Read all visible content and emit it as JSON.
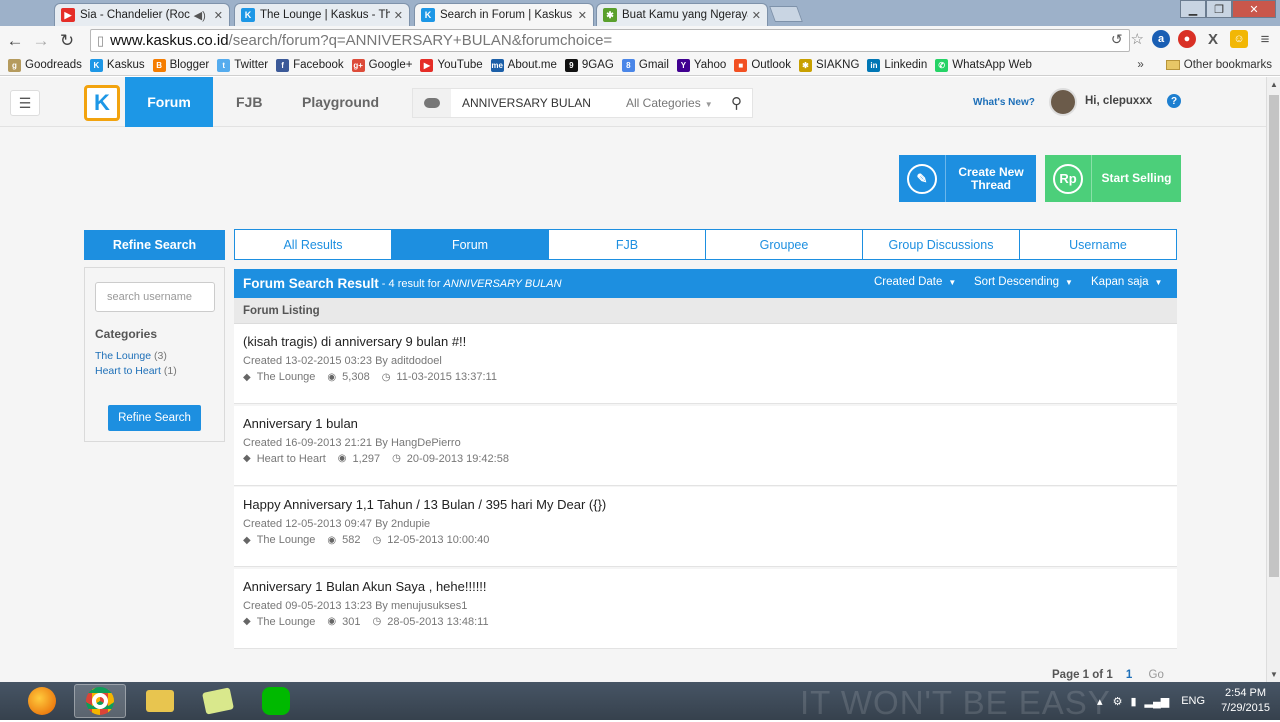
{
  "browser": {
    "tabs": [
      {
        "title": "Sia - Chandelier (Rock",
        "icon": "youtube-icon",
        "color": "#e52d27",
        "glyph": "▶"
      },
      {
        "title": "The Lounge | Kaskus - The",
        "icon": "kaskus-icon",
        "color": "#1d97e6",
        "glyph": "K"
      },
      {
        "title": "Search in Forum | Kaskus",
        "icon": "kaskus-icon",
        "color": "#1d97e6",
        "glyph": "K"
      },
      {
        "title": "Buat Kamu yang Ngeraya",
        "icon": "puzzle-icon",
        "color": "#5aa02c",
        "glyph": "✱"
      }
    ],
    "url_host": "www.kaskus.co.id",
    "url_path": "/search/forum?q=ANNIVERSARY+BULAN&forumchoice=",
    "bookmarks": [
      {
        "label": "Goodreads",
        "color": "#b59b5e",
        "glyph": "g"
      },
      {
        "label": "Kaskus",
        "color": "#1d97e6",
        "glyph": "K"
      },
      {
        "label": "Blogger",
        "color": "#f57d00",
        "glyph": "B"
      },
      {
        "label": "Twitter",
        "color": "#55acee",
        "glyph": "t"
      },
      {
        "label": "Facebook",
        "color": "#3b5998",
        "glyph": "f"
      },
      {
        "label": "Google+",
        "color": "#dd4b39",
        "glyph": "g+"
      },
      {
        "label": "YouTube",
        "color": "#e52d27",
        "glyph": "▶"
      },
      {
        "label": "About.me",
        "color": "#1b5fa8",
        "glyph": "me"
      },
      {
        "label": "9GAG",
        "color": "#111111",
        "glyph": "9"
      },
      {
        "label": "Gmail",
        "color": "#4a86e8",
        "glyph": "8"
      },
      {
        "label": "Yahoo",
        "color": "#400090",
        "glyph": "Y"
      },
      {
        "label": "Outlook",
        "color": "#f25022",
        "glyph": "■"
      },
      {
        "label": "SIAKNG",
        "color": "#c8a000",
        "glyph": "✱"
      },
      {
        "label": "Linkedin",
        "color": "#0077b5",
        "glyph": "in"
      },
      {
        "label": "WhatsApp Web",
        "color": "#25d366",
        "glyph": "✆"
      }
    ],
    "more": "»",
    "other_bookmarks": "Other bookmarks"
  },
  "header": {
    "logo": "K",
    "nav": [
      "Forum",
      "FJB",
      "Playground"
    ],
    "search_query": "ANNIVERSARY BULAN",
    "search_category": "All Categories",
    "whats_new": "What's New?",
    "greeting": "Hi, clepuxxx",
    "help": "?"
  },
  "actions": {
    "create_thread": "Create New Thread",
    "start_selling": "Start Selling",
    "sell_icon": "Rp"
  },
  "sidebar": {
    "heading": "Refine Search",
    "username_placeholder": "search username",
    "categories_title": "Categories",
    "categories": [
      {
        "name": "The Lounge",
        "count": "(3)"
      },
      {
        "name": "Heart to Heart",
        "count": "(1)"
      }
    ],
    "button": "Refine Search"
  },
  "tabs": [
    "All Results",
    "Forum",
    "FJB",
    "Groupee",
    "Group Discussions",
    "Username"
  ],
  "active_tab": "Forum",
  "results": {
    "title": "Forum Search Result",
    "summary_prefix": "- 4 result for",
    "query": "ANNIVERSARY BULAN",
    "sort_by": "Created Date",
    "sort_order": "Sort Descending",
    "time_range": "Kapan saja",
    "listing_label": "Forum Listing",
    "items": [
      {
        "title": "(kisah tragis) di anniversary 9 bulan #!!",
        "meta": "Created 13-02-2015 03:23 By aditdodoel",
        "category": "The Lounge",
        "views": "5,308",
        "last": "11-03-2015 13:37:11"
      },
      {
        "title": "Anniversary 1 bulan",
        "meta": "Created 16-09-2013 21:21 By HangDePierro",
        "category": "Heart to Heart",
        "views": "1,297",
        "last": "20-09-2013 19:42:58"
      },
      {
        "title": "Happy Anniversary 1,1 Tahun / 13 Bulan / 395 hari My Dear ({})",
        "meta": "Created 12-05-2013 09:47 By 2ndupie",
        "category": "The Lounge",
        "views": "582",
        "last": "12-05-2013 10:00:40"
      },
      {
        "title": "Anniversary 1 Bulan Akun Saya , hehe!!!!!!",
        "meta": "Created 09-05-2013 13:23 By menujusukses1",
        "category": "The Lounge",
        "views": "301",
        "last": "28-05-2013 13:48:11"
      }
    ],
    "page_label": "Page 1 of 1",
    "page_number": "1",
    "go": "Go"
  },
  "taskbar": {
    "wallpaper_text": "IT WON'T BE EASY",
    "lang": "ENG",
    "time": "2:54 PM",
    "date": "7/29/2015"
  },
  "colors": {
    "accent": "#1d8fe0",
    "sell": "#4ccf7a",
    "logo_border": "#f2a30f"
  }
}
